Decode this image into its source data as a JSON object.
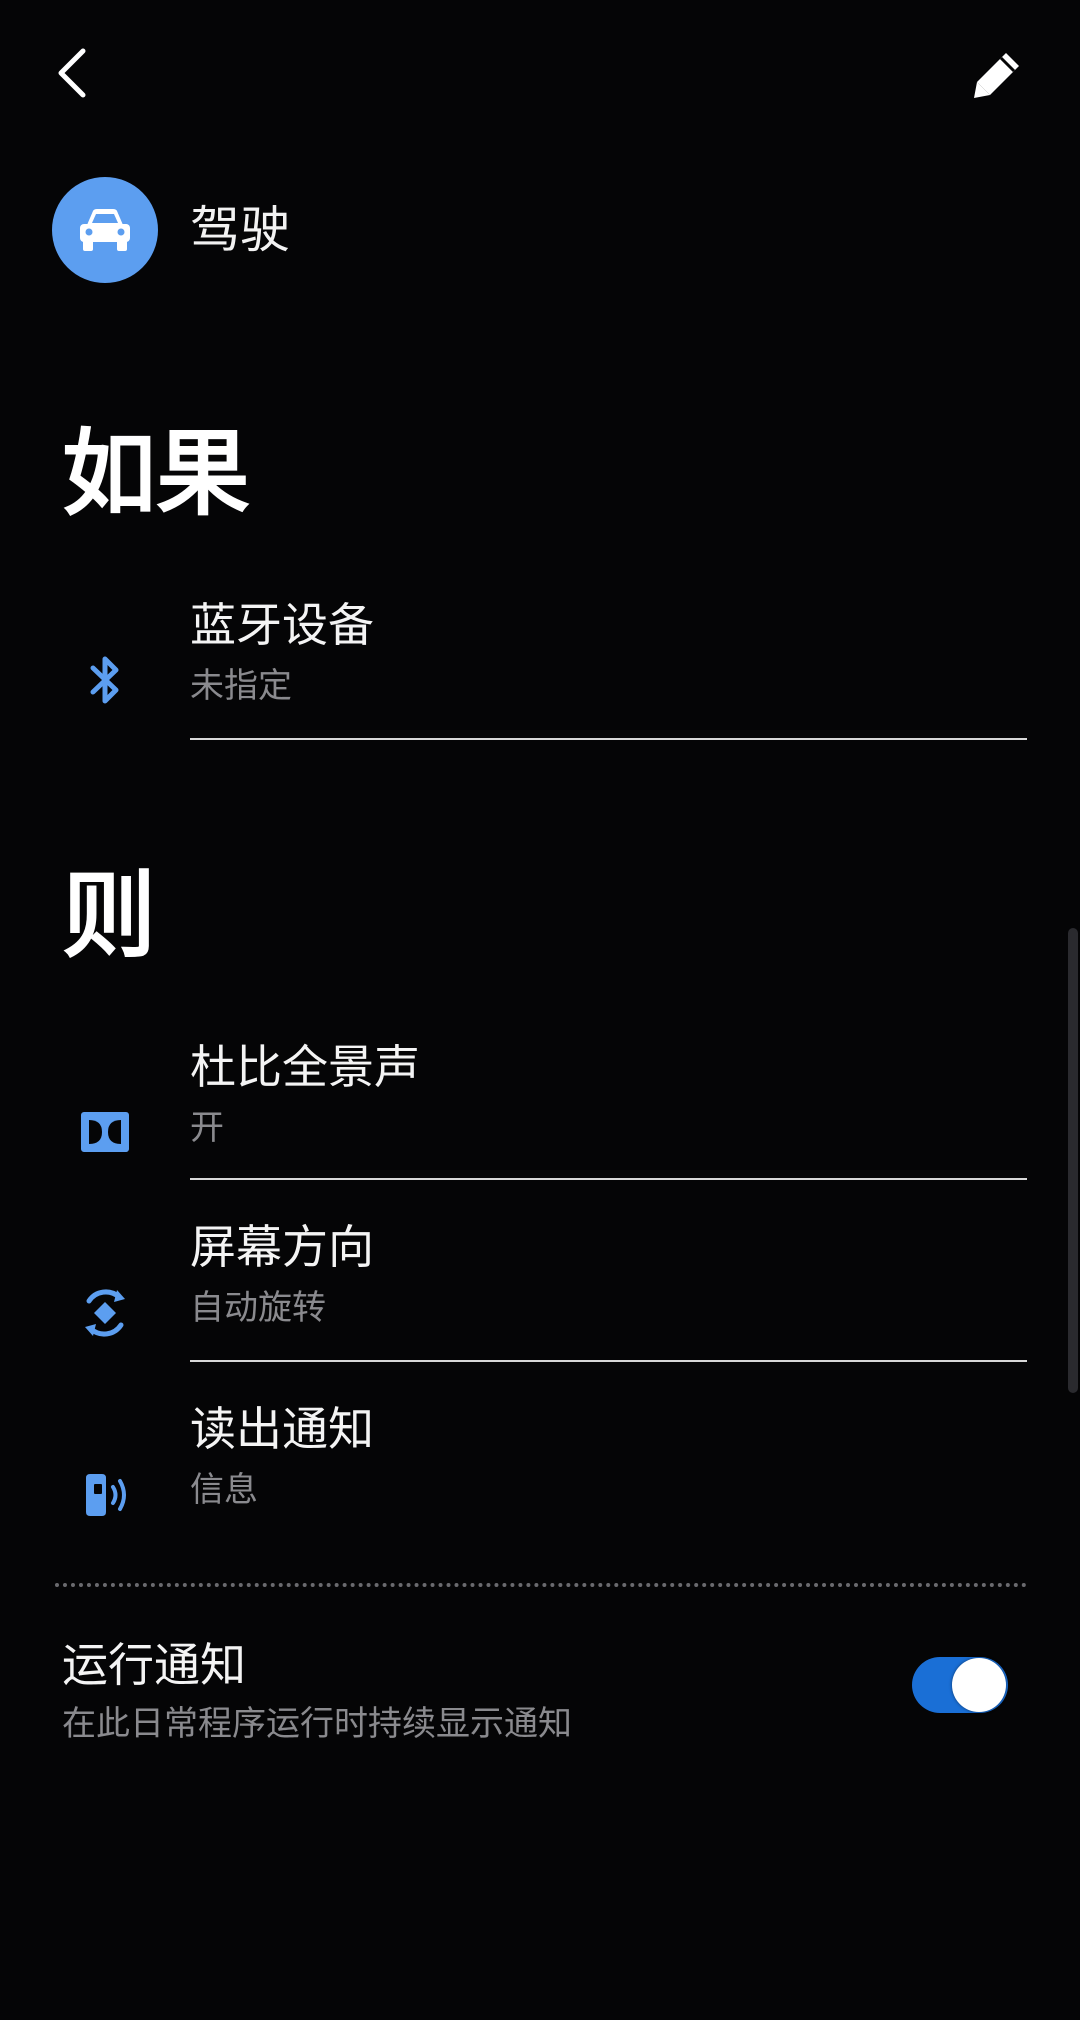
{
  "header": {
    "back_icon": "chevron-left-icon",
    "edit_icon": "pencil-icon"
  },
  "routine": {
    "icon": "car-icon",
    "icon_color": "#5c9ef0",
    "name": "驾驶"
  },
  "if_section": {
    "title": "如果",
    "items": [
      {
        "icon": "bluetooth-icon",
        "title": "蓝牙设备",
        "subtitle": "未指定"
      }
    ]
  },
  "then_section": {
    "title": "则",
    "items": [
      {
        "icon": "dolby-icon",
        "title": "杜比全景声",
        "subtitle": "开"
      },
      {
        "icon": "screen-rotation-icon",
        "title": "屏幕方向",
        "subtitle": "自动旋转"
      },
      {
        "icon": "read-aloud-icon",
        "title": "读出通知",
        "subtitle": "信息"
      }
    ]
  },
  "running_notification": {
    "title": "运行通知",
    "subtitle": "在此日常程序运行时持续显示通知",
    "enabled": true,
    "toggle_color": "#1a6fd6"
  },
  "colors": {
    "background": "#050506",
    "accent_icon": "#5c9ef0",
    "secondary_text": "#8a8a8e"
  }
}
